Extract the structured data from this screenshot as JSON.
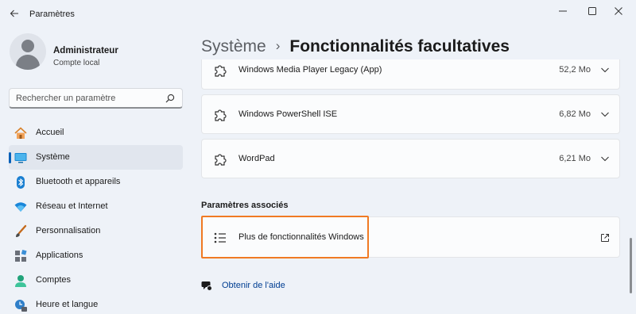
{
  "window": {
    "title": "Paramètres"
  },
  "user": {
    "name": "Administrateur",
    "account_type": "Compte local"
  },
  "search": {
    "placeholder": "Rechercher un paramètre"
  },
  "nav": {
    "items": [
      {
        "label": "Accueil",
        "icon": "home-icon",
        "active": false
      },
      {
        "label": "Système",
        "icon": "system-icon",
        "active": true
      },
      {
        "label": "Bluetooth et appareils",
        "icon": "bluetooth-icon",
        "active": false
      },
      {
        "label": "Réseau et Internet",
        "icon": "wifi-icon",
        "active": false
      },
      {
        "label": "Personnalisation",
        "icon": "brush-icon",
        "active": false
      },
      {
        "label": "Applications",
        "icon": "apps-icon",
        "active": false
      },
      {
        "label": "Comptes",
        "icon": "person-icon",
        "active": false
      },
      {
        "label": "Heure et langue",
        "icon": "clock-icon",
        "active": false
      }
    ]
  },
  "breadcrumb": {
    "parent": "Système",
    "separator": "›",
    "current": "Fonctionnalités facultatives"
  },
  "features": [
    {
      "name": "Windows Media Player Legacy (App)",
      "size": "52,2 Mo"
    },
    {
      "name": "Windows PowerShell ISE",
      "size": "6,82 Mo"
    },
    {
      "name": "WordPad",
      "size": "6,21 Mo"
    }
  ],
  "related": {
    "title": "Paramètres associés",
    "items": [
      {
        "label": "Plus de fonctionnalités Windows",
        "icon": "list-icon",
        "action_icon": "open-external-icon"
      }
    ]
  },
  "help": {
    "label": "Obtenir de l'aide"
  },
  "colors": {
    "accent": "#005fb8",
    "highlight": "#f07a23",
    "link": "#003e92",
    "background": "#eef2f8",
    "card": "#fbfcfd"
  }
}
